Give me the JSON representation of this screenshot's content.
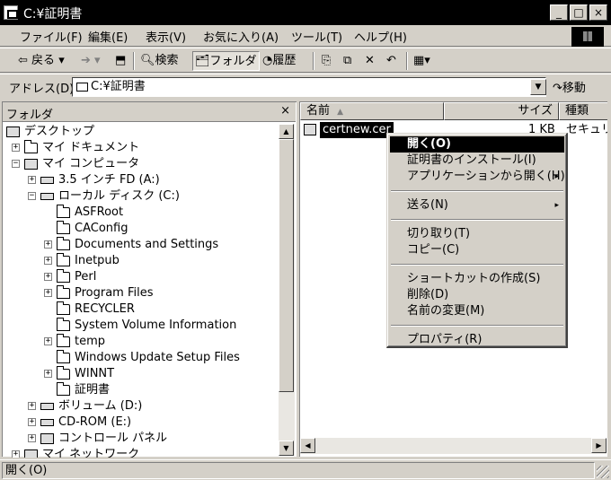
{
  "window": {
    "title": "C:¥証明書",
    "buttons": {
      "minimize": "_",
      "maximize": "□",
      "close": "×"
    }
  },
  "menubar": [
    "ファイル(F)",
    "編集(E)",
    "表示(V)",
    "お気に入り(A)",
    "ツール(T)",
    "ヘルプ(H)"
  ],
  "toolbar": {
    "back": "戻る",
    "forward_glyph": "➔",
    "search": "検索",
    "folders": "フォルダ",
    "history": "履歴",
    "dropdown_glyph": "▾"
  },
  "address": {
    "label": "アドレス(D)",
    "value": "C:¥証明書",
    "go": "移動"
  },
  "folders": {
    "header": "フォルダ",
    "close": "×",
    "items": [
      {
        "label": "デスクトップ",
        "level": 0,
        "expander": "",
        "icon": "pc"
      },
      {
        "label": "マイ ドキュメント",
        "level": 1,
        "expander": "+",
        "icon": "folder"
      },
      {
        "label": "マイ コンピュータ",
        "level": 1,
        "expander": "−",
        "icon": "pc"
      },
      {
        "label": "3.5 インチ FD (A:)",
        "level": 2,
        "expander": "+",
        "icon": "drive"
      },
      {
        "label": "ローカル ディスク (C:)",
        "level": 2,
        "expander": "−",
        "icon": "drive"
      },
      {
        "label": "ASFRoot",
        "level": 3,
        "expander": "",
        "icon": "folder"
      },
      {
        "label": "CAConfig",
        "level": 3,
        "expander": "",
        "icon": "folder"
      },
      {
        "label": "Documents and Settings",
        "level": 3,
        "expander": "+",
        "icon": "folder"
      },
      {
        "label": "Inetpub",
        "level": 3,
        "expander": "+",
        "icon": "folder"
      },
      {
        "label": "Perl",
        "level": 3,
        "expander": "+",
        "icon": "folder"
      },
      {
        "label": "Program Files",
        "level": 3,
        "expander": "+",
        "icon": "folder"
      },
      {
        "label": "RECYCLER",
        "level": 3,
        "expander": "",
        "icon": "folder"
      },
      {
        "label": "System Volume Information",
        "level": 3,
        "expander": "",
        "icon": "folder"
      },
      {
        "label": "temp",
        "level": 3,
        "expander": "+",
        "icon": "folder"
      },
      {
        "label": "Windows Update Setup Files",
        "level": 3,
        "expander": "",
        "icon": "folder"
      },
      {
        "label": "WINNT",
        "level": 3,
        "expander": "+",
        "icon": "folder"
      },
      {
        "label": "証明書",
        "level": 3,
        "expander": "",
        "icon": "folder"
      },
      {
        "label": "ボリューム (D:)",
        "level": 2,
        "expander": "+",
        "icon": "drive"
      },
      {
        "label": "CD-ROM (E:)",
        "level": 2,
        "expander": "+",
        "icon": "drive"
      },
      {
        "label": "コントロール パネル",
        "level": 2,
        "expander": "+",
        "icon": "pc"
      },
      {
        "label": "マイ ネットワーク",
        "level": 1,
        "expander": "+",
        "icon": "pc"
      }
    ]
  },
  "files": {
    "columns": {
      "name": "名前",
      "size": "サイズ",
      "type": "種類"
    },
    "sort_glyph": "▲",
    "rows": [
      {
        "name": "certnew.cer",
        "size": "1 KB",
        "type": "セキュリティ証明書"
      }
    ]
  },
  "context_menu": {
    "items": [
      {
        "label": "開く(O)",
        "highlighted": true,
        "submenu": false
      },
      {
        "label": "証明書のインストール(I)",
        "submenu": false
      },
      {
        "label": "アプリケーションから開く(H)",
        "submenu": true
      },
      {
        "sep": true
      },
      {
        "label": "送る(N)",
        "submenu": true
      },
      {
        "sep": true
      },
      {
        "label": "切り取り(T)",
        "submenu": false
      },
      {
        "label": "コピー(C)",
        "submenu": false
      },
      {
        "sep": true
      },
      {
        "label": "ショートカットの作成(S)",
        "submenu": false
      },
      {
        "label": "削除(D)",
        "submenu": false
      },
      {
        "label": "名前の変更(M)",
        "submenu": false
      },
      {
        "sep": true
      },
      {
        "label": "プロパティ(R)",
        "submenu": false
      }
    ],
    "submenu_glyph": "▸"
  },
  "status": {
    "text": "開く(O)"
  },
  "scroll": {
    "up": "▲",
    "down": "▼",
    "left": "◀",
    "right": "▶"
  },
  "colors": {
    "titlebar": "#000000",
    "face": "#d4d0c8",
    "highlight": "#000000"
  }
}
